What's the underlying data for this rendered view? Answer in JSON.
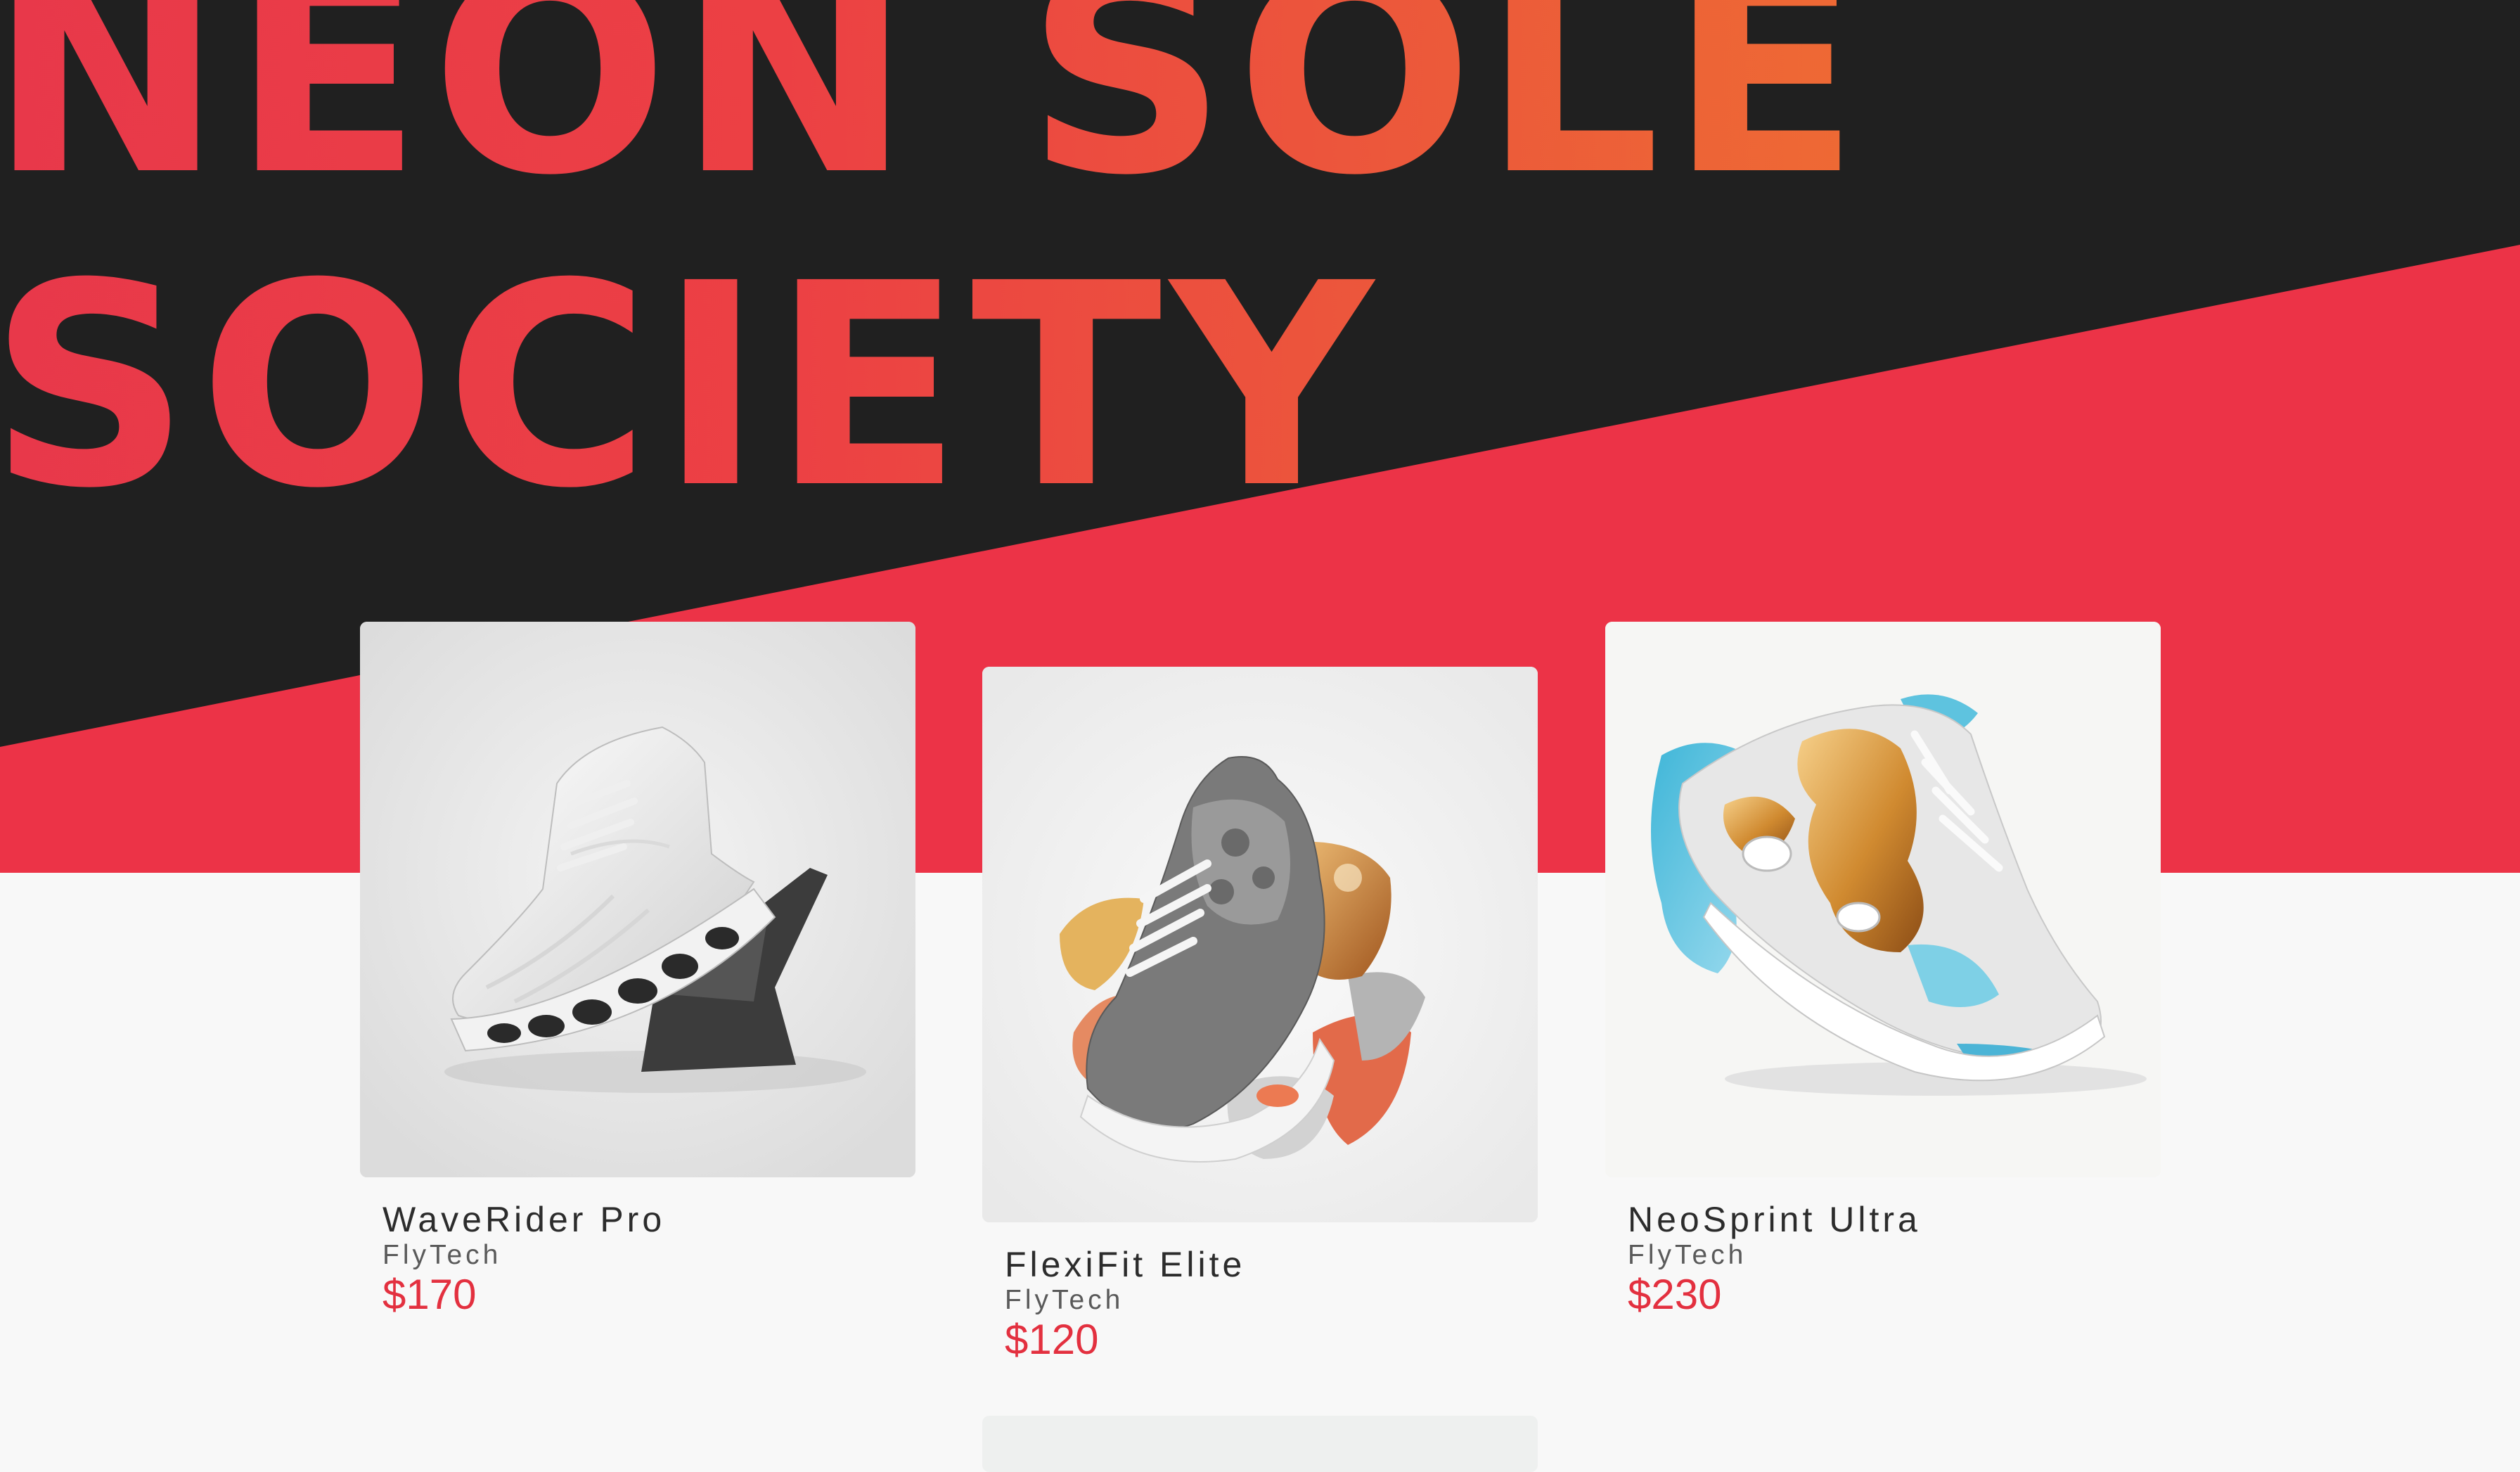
{
  "brand": {
    "title_line_1": "NEON SOLE",
    "title_line_2": "SOCIETY"
  },
  "colors": {
    "hero_dark": "#202020",
    "hero_accent": "#ec3347",
    "price": "#e3303f",
    "page_bg": "#f8f8f8"
  },
  "products": [
    {
      "name": "WaveRider Pro",
      "brand": "FlyTech",
      "price": "$170",
      "image_icon": "white-sculpted-sneaker-image"
    },
    {
      "name": "FlexiFit Elite",
      "brand": "FlyTech",
      "price": "$120",
      "image_icon": "gray-abstract-sneaker-image"
    },
    {
      "name": "NeoSprint Ultra",
      "brand": "FlyTech",
      "price": "$230",
      "image_icon": "iridescent-gold-sneaker-image"
    }
  ]
}
